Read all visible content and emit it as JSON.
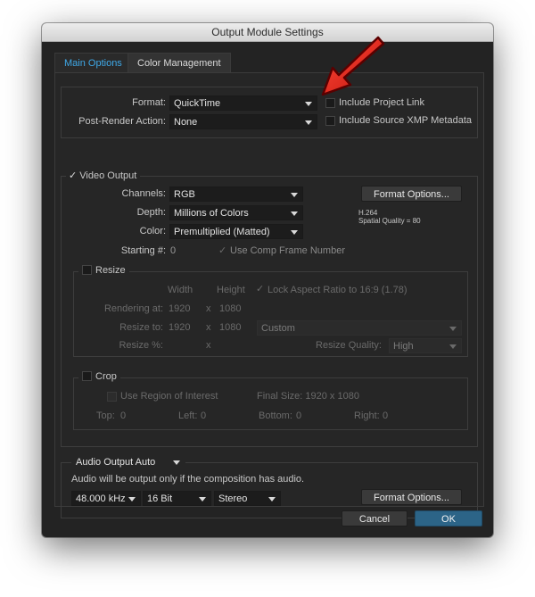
{
  "dialog": {
    "title": "Output Module Settings"
  },
  "tabs": [
    {
      "label": "Main Options",
      "active": true
    },
    {
      "label": "Color Management",
      "active": false
    }
  ],
  "format_section": {
    "format_label": "Format:",
    "format_value": "QuickTime",
    "post_render_label": "Post-Render Action:",
    "post_render_value": "None",
    "include_project_link_label": "Include Project Link",
    "include_xmp_label": "Include Source XMP Metadata",
    "include_project_link_checked": false,
    "include_xmp_checked": false
  },
  "video_output": {
    "enabled": true,
    "label": "Video Output",
    "channels_label": "Channels:",
    "channels_value": "RGB",
    "depth_label": "Depth:",
    "depth_value": "Millions of Colors",
    "color_label": "Color:",
    "color_value": "Premultiplied (Matted)",
    "starting_label": "Starting #:",
    "starting_value": "0",
    "use_comp_frame_label": "Use Comp Frame Number",
    "format_options_label": "Format Options...",
    "codec_info_line1": "H.264",
    "codec_info_line2": "Spatial Quality = 80"
  },
  "resize": {
    "label": "Resize",
    "enabled": false,
    "width_header": "Width",
    "height_header": "Height",
    "lock_aspect_label": "Lock Aspect Ratio to 16:9 (1.78)",
    "rendering_at_label": "Rendering at:",
    "rendering_w": "1920",
    "rendering_h": "1080",
    "resize_to_label": "Resize to:",
    "resize_to_w": "1920",
    "resize_to_h": "1080",
    "resize_to_preset": "Custom",
    "resize_pct_label": "Resize %:",
    "quality_label": "Resize Quality:",
    "quality_value": "High",
    "x_sep": "x"
  },
  "crop": {
    "label": "Crop",
    "enabled": false,
    "use_roi_label": "Use Region of Interest",
    "final_size": "Final Size: 1920 x 1080",
    "top_label": "Top:",
    "top_value": "0",
    "left_label": "Left:",
    "left_value": "0",
    "bottom_label": "Bottom:",
    "bottom_value": "0",
    "right_label": "Right:",
    "right_value": "0"
  },
  "audio": {
    "mode": "Audio Output Auto",
    "note": "Audio will be output only if the composition has audio.",
    "rate": "48.000 kHz",
    "bits": "16 Bit",
    "channels": "Stereo",
    "format_options_label": "Format Options..."
  },
  "footer": {
    "cancel_label": "Cancel",
    "ok_label": "OK"
  },
  "colors": {
    "accent": "#3fa9e8",
    "primary_button": "#2c6487",
    "arrow": "#e0251b"
  },
  "icons": [
    "checkmark-icon",
    "dropdown-arrow-icon",
    "annotation-arrow-icon"
  ]
}
